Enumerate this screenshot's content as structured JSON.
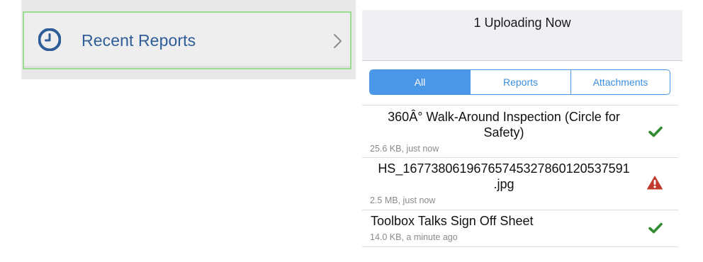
{
  "recent_reports": {
    "label": "Recent Reports",
    "icon": "clock-icon",
    "chevron": "chevron-right-icon",
    "label_color": "#2e5d98",
    "highlight_border_color": "#9fdc93"
  },
  "upload_queue": {
    "header_title": "1 Uploading Now",
    "segments": {
      "all": "All",
      "reports": "Reports",
      "attachments": "Attachments",
      "selected": "All",
      "accent_color": "#4a97e8"
    },
    "items": [
      {
        "title_line1": "360Â° Walk-Around Inspection (Circle for",
        "title_line2": "Safety)",
        "meta": "25.6 KB, just now",
        "status": "success",
        "status_icon": "checkmark-icon",
        "status_color": "#2e8b2e"
      },
      {
        "title_line1": "HS_16773806196765745327860120537591",
        "title_line2": ".jpg",
        "meta": "2.5 MB, just now",
        "status": "error",
        "status_icon": "warning-triangle-icon",
        "status_color": "#c0392b"
      },
      {
        "title_line1": "Toolbox Talks Sign Off Sheet",
        "meta": "14.0 KB, a minute ago",
        "status": "success",
        "status_icon": "checkmark-icon",
        "status_color": "#2e8b2e"
      }
    ]
  }
}
